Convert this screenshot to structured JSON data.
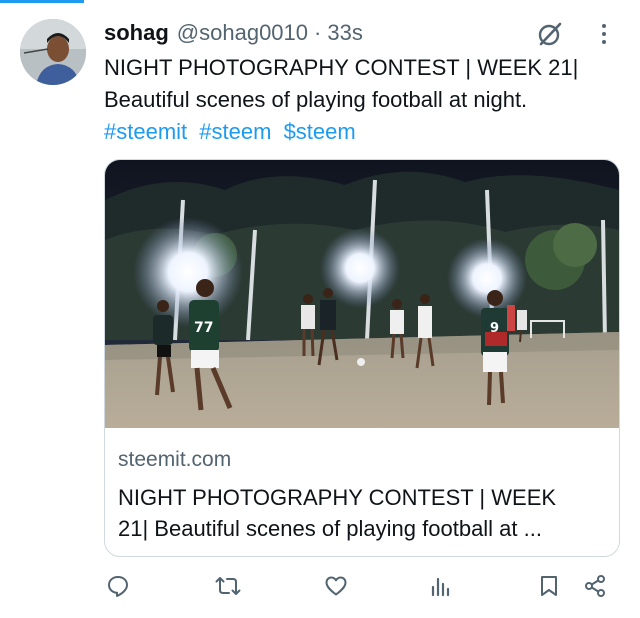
{
  "user": {
    "name": "sohag",
    "handle": "@sohag0010",
    "separator": "·",
    "time": "33s"
  },
  "icons": {
    "grok": "grok-icon",
    "more": "more-icon",
    "reply": "reply-icon",
    "retweet": "retweet-icon",
    "like": "heart-icon",
    "views": "views-icon",
    "bookmark": "bookmark-icon",
    "share": "share-icon"
  },
  "tweet": {
    "line1": "NIGHT PHOTOGRAPHY CONTEST | WEEK 21|",
    "line2": "Beautiful scenes of playing football at night.",
    "hashtags": [
      "#steemit",
      "#steem",
      "$steem"
    ]
  },
  "card": {
    "domain": "steemit.com",
    "title_line1": "NIGHT PHOTOGRAPHY CONTEST | WEEK",
    "title_line2": "21| Beautiful scenes of playing football at ..."
  },
  "colors": {
    "accent": "#1d9bf0",
    "text": "#0f1419",
    "secondary": "#536471",
    "border": "#cfd9de"
  }
}
